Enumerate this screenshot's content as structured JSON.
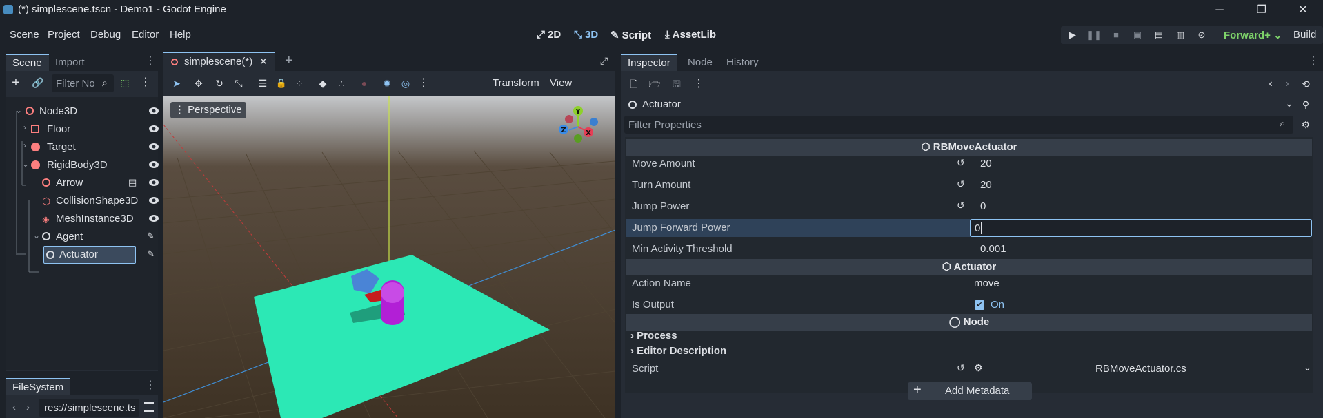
{
  "window": {
    "title": "(*) simplescene.tscn - Demo1 - Godot Engine",
    "minimize": "─",
    "maximize": "❐",
    "close": "✕"
  },
  "menu": [
    "Scene",
    "Project",
    "Debug",
    "Editor",
    "Help"
  ],
  "workspaces": [
    {
      "label": "2D",
      "icon": "2d-icon"
    },
    {
      "label": "3D",
      "icon": "3d-icon",
      "active": true
    },
    {
      "label": "Script",
      "icon": "script-icon"
    },
    {
      "label": "AssetLib",
      "icon": "assetlib-icon"
    }
  ],
  "renderer": "Forward+",
  "build_label": "Build",
  "scene_dock": {
    "tabs": [
      "Scene",
      "Import"
    ],
    "filter_placeholder": "Filter No",
    "tree": [
      {
        "label": "Node3D",
        "depth": 0,
        "icon": "node3d-icon"
      },
      {
        "label": "Floor",
        "depth": 1,
        "icon": "floor-icon"
      },
      {
        "label": "Target",
        "depth": 1,
        "icon": "target-icon"
      },
      {
        "label": "RigidBody3D",
        "depth": 1,
        "icon": "rigidbody-icon"
      },
      {
        "label": "Arrow",
        "depth": 2,
        "icon": "node3d-icon"
      },
      {
        "label": "CollisionShape3D",
        "depth": 2,
        "icon": "collision-icon"
      },
      {
        "label": "MeshInstance3D",
        "depth": 2,
        "icon": "mesh-icon"
      },
      {
        "label": "Agent",
        "depth": 1,
        "icon": "node-icon"
      },
      {
        "label": "Actuator",
        "depth": 2,
        "icon": "node-icon",
        "selected": true
      }
    ]
  },
  "filesystem": {
    "tab": "FileSystem",
    "path": "res://simplescene.ts"
  },
  "editor_tab": {
    "label": "simplescene(*)",
    "close": "✕",
    "add": "+"
  },
  "viewport_toolbar": {
    "transform": "Transform",
    "view": "View"
  },
  "viewport": {
    "perspective": "Perspective",
    "gizmo": {
      "y": "Y",
      "x": "X",
      "z": "Z"
    }
  },
  "inspector": {
    "tabs": [
      "Inspector",
      "Node",
      "History"
    ],
    "object_name": "Actuator",
    "filter_placeholder": "Filter Properties",
    "sections": {
      "rbmove": "RBMoveActuator",
      "actuator": "Actuator",
      "node": "Node"
    },
    "rbmove_props": [
      {
        "name": "Move Amount",
        "value": "20",
        "revert": true
      },
      {
        "name": "Turn Amount",
        "value": "20",
        "revert": true
      },
      {
        "name": "Jump Power",
        "value": "0",
        "revert": true
      },
      {
        "name": "Jump Forward Power",
        "value": "0",
        "editing": true
      },
      {
        "name": "Min Activity Threshold",
        "value": "0.001"
      }
    ],
    "action_name": {
      "name": "Action Name",
      "value": "move"
    },
    "is_output": {
      "name": "Is Output",
      "value": "On"
    },
    "groups": [
      "Process",
      "Editor Description"
    ],
    "script": {
      "name": "Script",
      "value": "RBMoveActuator.cs"
    },
    "add_metadata": "Add Metadata"
  },
  "colors": {
    "accent": "#8ec3f2",
    "floor": "#2ce8b5",
    "renderer": "#7ed36a"
  }
}
